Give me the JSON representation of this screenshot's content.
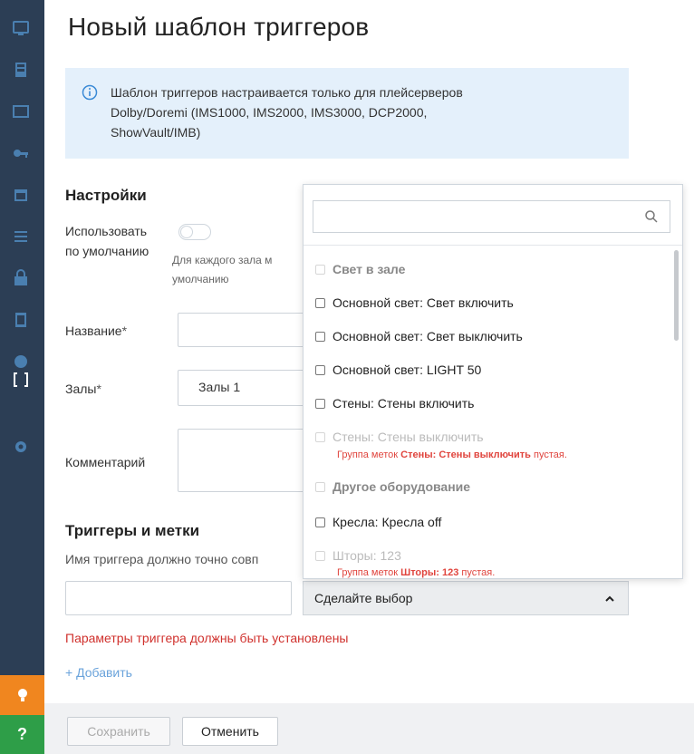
{
  "page": {
    "title": "Новый шаблон триггеров"
  },
  "info": {
    "line1": "Шаблон триггеров настраивается только для плейсерверов",
    "line2": "Dolby/Doremi (IMS1000, IMS2000, IMS3000, DCP2000,",
    "line3": "ShowVault/IMB)"
  },
  "settings": {
    "title": "Настройки",
    "default_label_1": "Использовать",
    "default_label_2": "по умолчанию",
    "default_hint_1": "Для каждого зала м",
    "default_hint_2": "умолчанию",
    "name_label": "Название",
    "halls_label": "Залы",
    "halls_value": "Залы 1",
    "comment_label": "Комментарий",
    "required_mark": "*"
  },
  "triggers": {
    "title": "Триггеры и метки",
    "hint": "Имя триггера должно точно совп",
    "select_placeholder": "Сделайте выбор",
    "error": "Параметры триггера должны быть установлены",
    "add": "+ Добавить"
  },
  "dropdown": {
    "search_value": "",
    "items": [
      {
        "label": "Свет в зале",
        "kind": "group"
      },
      {
        "label": "Основной свет: Свет включить",
        "kind": "option"
      },
      {
        "label": "Основной свет: Свет выключить",
        "kind": "option"
      },
      {
        "label": "Основной свет: LIGHT 50",
        "kind": "option"
      },
      {
        "label": "Стены: Стены включить",
        "kind": "option"
      },
      {
        "label": "Стены: Стены выключить",
        "kind": "disabled"
      },
      {
        "label": "Другое оборудование",
        "kind": "group"
      },
      {
        "label": "Кресла: Кресла off",
        "kind": "option"
      },
      {
        "label": "Шторы: 123",
        "kind": "disabled"
      }
    ],
    "notes": [
      {
        "prefix": "Группа меток ",
        "bold": "Стены: Стены выключить",
        "suffix": " пустая."
      },
      {
        "prefix": "Группа меток ",
        "bold": "Шторы: 123",
        "suffix": " пустая."
      }
    ]
  },
  "footer": {
    "save": "Сохранить",
    "cancel": "Отменить"
  },
  "sidebar": {
    "icons": [
      "monitor-icon",
      "film-icon",
      "screen-icon",
      "key-icon",
      "calendar-icon",
      "list-icon",
      "lock-icon",
      "document-icon",
      "circle-icon",
      "brackets-icon",
      "gear-icon"
    ],
    "help_glyph": "?"
  },
  "colors": {
    "sidebar": "#2c3e55",
    "info_bg": "#e4f0fb",
    "error": "#d0312d",
    "link": "#6aa3db",
    "orange": "#f0861f",
    "green": "#2e9e48"
  }
}
